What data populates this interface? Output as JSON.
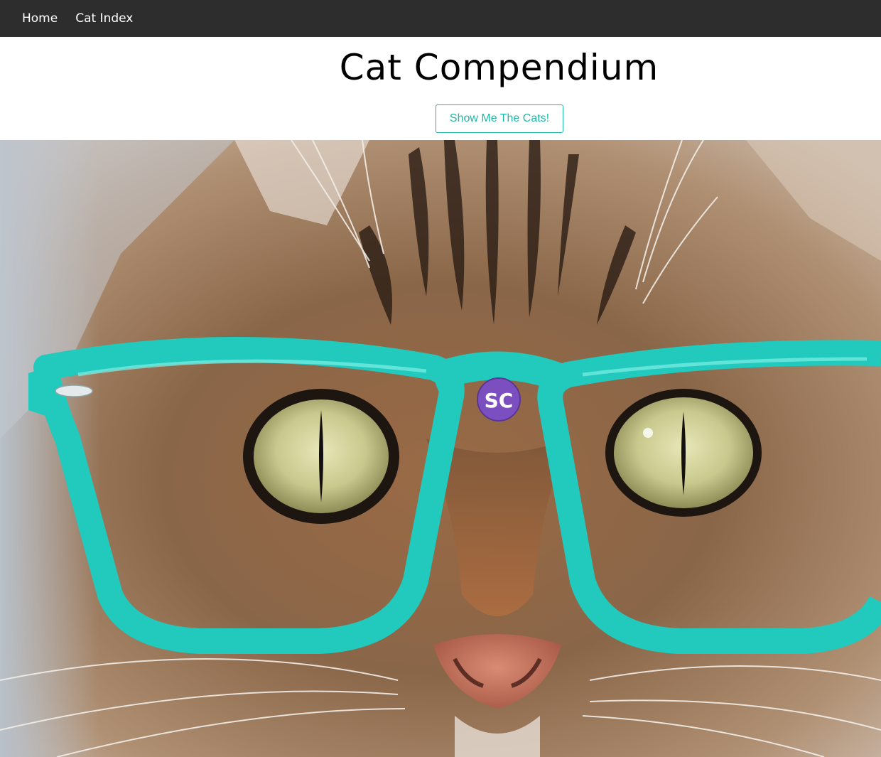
{
  "nav": {
    "items": [
      {
        "label": "Home"
      },
      {
        "label": "Cat Index"
      }
    ]
  },
  "header": {
    "title": "Cat Compendium",
    "cta_label": "Show Me The Cats!"
  },
  "hero": {
    "badge_text": "SC"
  },
  "colors": {
    "navbar_bg": "#2d2d2d",
    "accent": "#1fb8a5",
    "glasses": "#22c9bd",
    "badge": "#7b4fc0"
  }
}
